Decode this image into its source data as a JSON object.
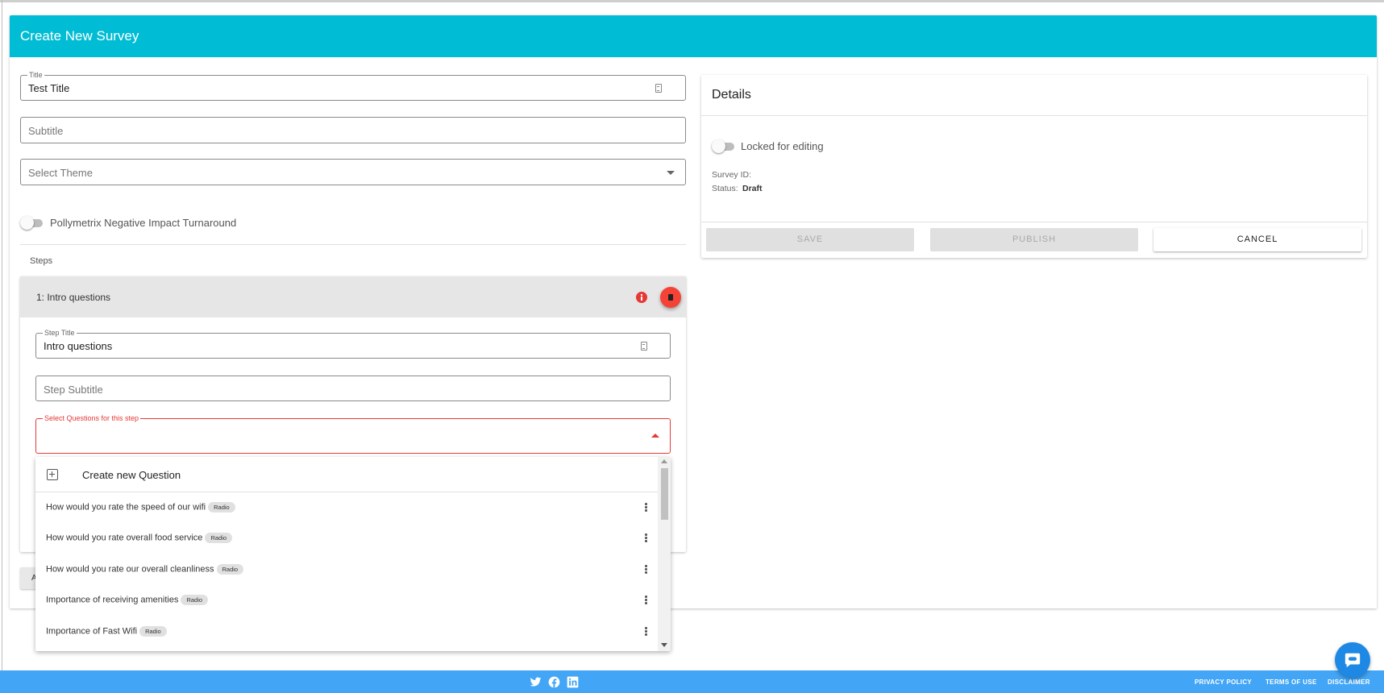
{
  "header": {
    "title": "Create New Survey"
  },
  "form": {
    "title_legend": "Title",
    "title_value": "Test Title",
    "subtitle_placeholder": "Subtitle",
    "theme_placeholder": "Select Theme",
    "pollymetrix_label": "Pollymetrix Negative Impact Turnaround",
    "pollymetrix_on": false,
    "steps_label": "Steps",
    "add_button_label": "A"
  },
  "step": {
    "header_label": "1: Intro questions",
    "title_legend": "Step Title",
    "title_value": "Intro questions",
    "subtitle_placeholder": "Step Subtitle",
    "questions_legend": "Select Questions for this step"
  },
  "dropdown": {
    "create_label": "Create new Question",
    "questions": [
      {
        "text": "How would you rate the speed of our wifi",
        "type": "Radio"
      },
      {
        "text": "How would you rate overall food service",
        "type": "Radio"
      },
      {
        "text": "How would you rate our overall cleanliness",
        "type": "Radio"
      },
      {
        "text": "Importance of receiving amenities",
        "type": "Radio"
      },
      {
        "text": "Importance of Fast Wifi",
        "type": "Radio"
      }
    ]
  },
  "details": {
    "title": "Details",
    "locked_label": "Locked for editing",
    "locked_on": false,
    "survey_id_label": "Survey ID:",
    "survey_id_value": "",
    "status_label": "Status:",
    "status_value": "Draft",
    "save_label": "SAVE",
    "publish_label": "PUBLISH",
    "cancel_label": "CANCEL"
  },
  "footer": {
    "social": [
      "twitter-icon",
      "facebook-icon",
      "linkedin-icon"
    ],
    "links": [
      "PRIVACY POLICY",
      "TERMS OF USE",
      "DISCLAIMER"
    ]
  },
  "colors": {
    "header": "#00bcd4",
    "footer": "#42a5f5",
    "error": "#e53935",
    "chat": "#1e88e5"
  }
}
